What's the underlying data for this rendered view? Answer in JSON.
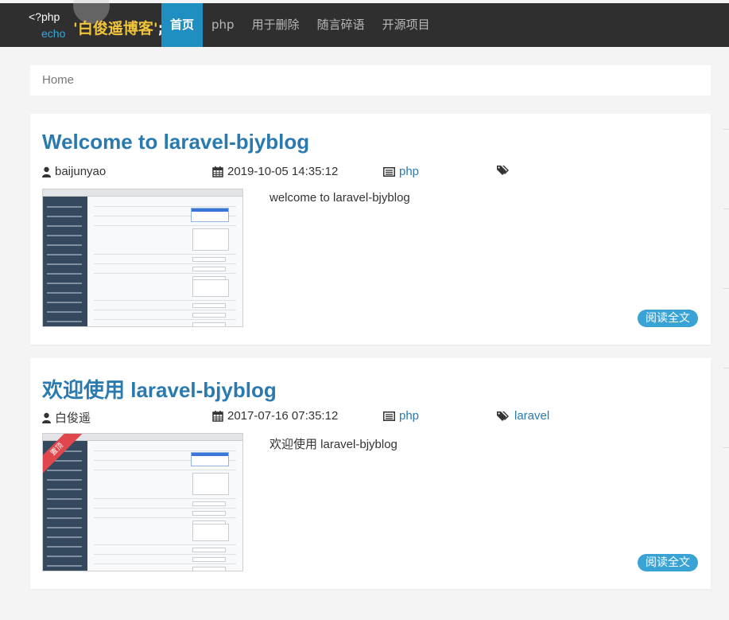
{
  "header": {
    "logo_php": "<?php",
    "logo_echo": "echo",
    "logo_name": "'白俊遥博客'",
    "logo_semi": ";",
    "nav": [
      {
        "label": "首页",
        "active": true
      },
      {
        "label": "php",
        "active": false
      },
      {
        "label": "用于删除",
        "active": false
      },
      {
        "label": "随言碎语",
        "active": false
      },
      {
        "label": "开源项目",
        "active": false
      }
    ]
  },
  "breadcrumb": "Home",
  "articles": [
    {
      "title": "Welcome to laravel-bjyblog",
      "author": "baijunyao",
      "date": "2019-10-05 14:35:12",
      "category": "php",
      "tags": "",
      "summary": "welcome to laravel-bjyblog",
      "read_more": "阅读全文",
      "pinned": false
    },
    {
      "title": "欢迎使用 laravel-bjyblog",
      "author": "白俊遥",
      "date": "2017-07-16 07:35:12",
      "category": "php",
      "tags": "laravel",
      "summary": "欢迎使用 laravel-bjyblog",
      "read_more": "阅读全文",
      "pinned": true,
      "ribbon": "置顶"
    }
  ],
  "colors": {
    "nav_bg": "#2f2f2f",
    "nav_active": "#1f8fc2",
    "logo_name": "#f2c43b",
    "link": "#2a7ab0",
    "read_more": "#3aa3d6"
  },
  "icons": {
    "author": "user-icon",
    "date": "calendar-icon",
    "category": "list-icon",
    "tags": "tags-icon"
  }
}
